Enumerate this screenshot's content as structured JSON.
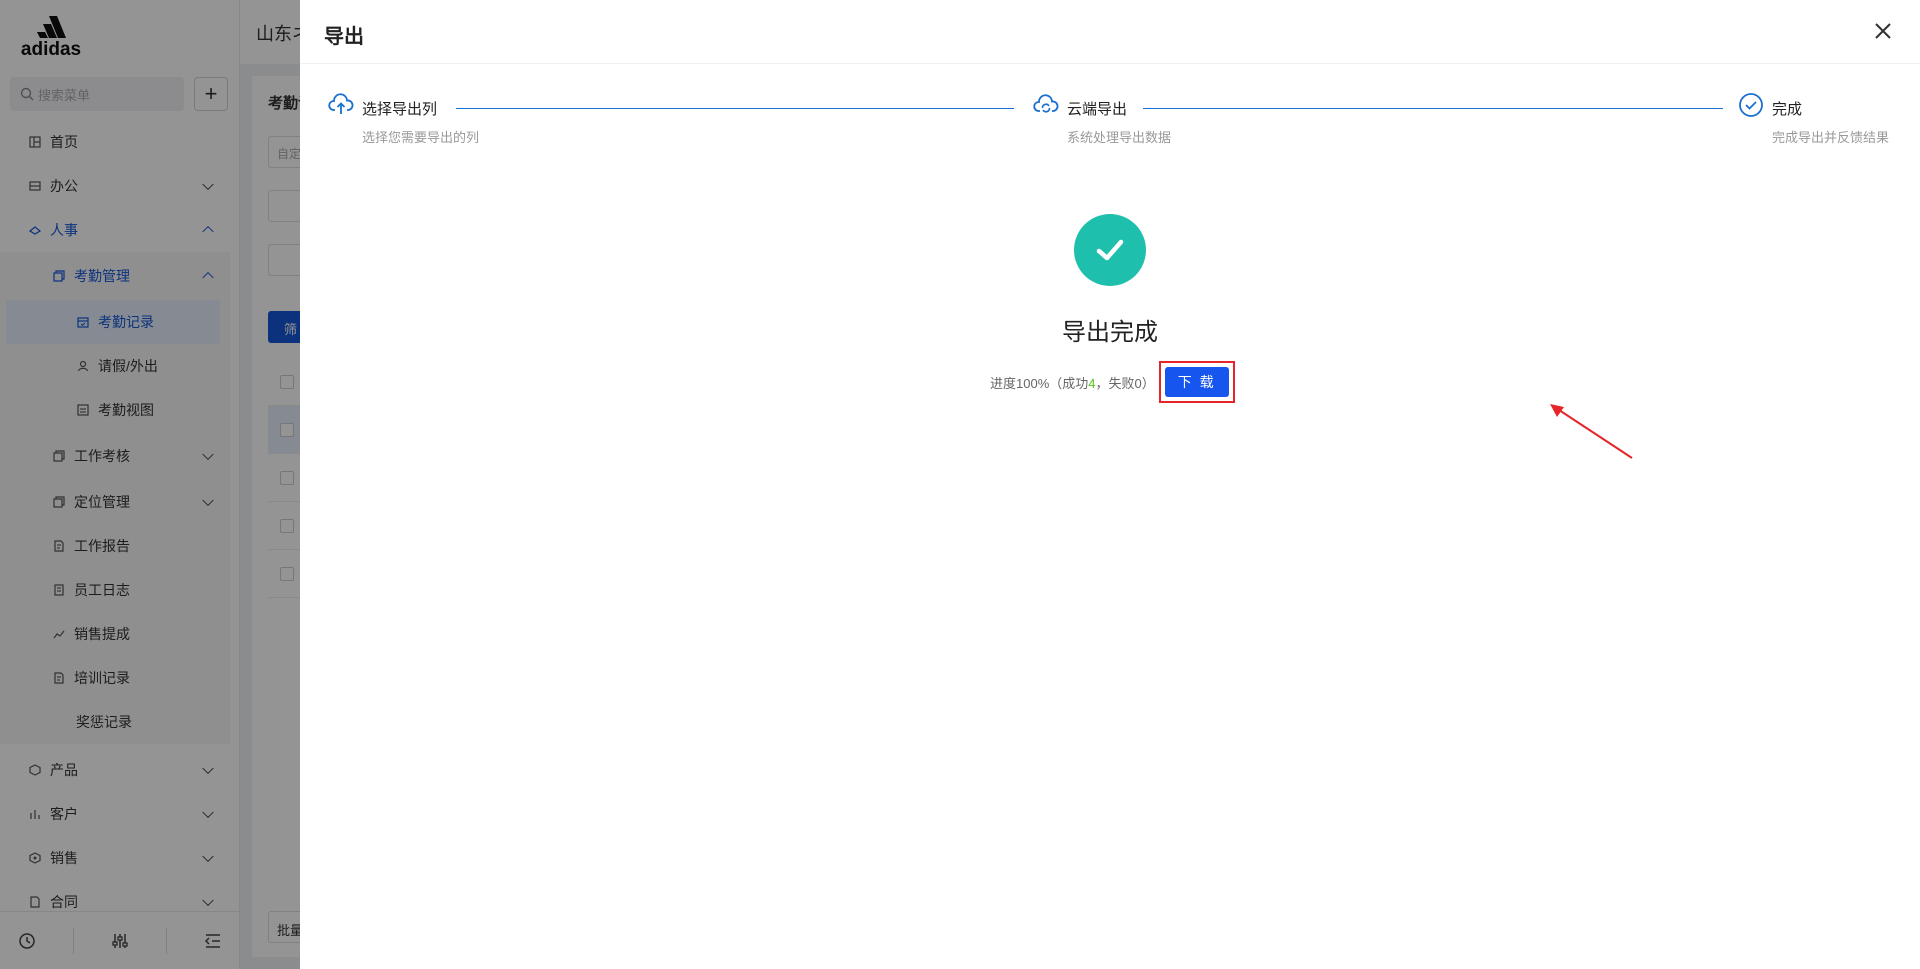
{
  "sidebar": {
    "logo_text": "adidas",
    "search_placeholder": "搜索菜单",
    "add_label": "+",
    "items": [
      {
        "label": "首页",
        "icon": "home-grid-icon"
      },
      {
        "label": "办公",
        "icon": "office-icon"
      },
      {
        "label": "人事",
        "icon": "hr-icon"
      },
      {
        "label": "考勤管理",
        "icon": "attendance-icon"
      },
      {
        "label": "考勤记录",
        "icon": "calendar-icon"
      },
      {
        "label": "请假/外出",
        "icon": "leave-icon"
      },
      {
        "label": "考勤视图",
        "icon": "view-icon"
      },
      {
        "label": "工作考核",
        "icon": "copy-icon"
      },
      {
        "label": "定位管理",
        "icon": "copy-icon"
      },
      {
        "label": "工作报告",
        "icon": "report-icon"
      },
      {
        "label": "员工日志",
        "icon": "log-icon"
      },
      {
        "label": "销售提成",
        "icon": "chart-icon"
      },
      {
        "label": "培训记录",
        "icon": "report-icon"
      },
      {
        "label": "奖惩记录",
        "icon": ""
      },
      {
        "label": "产品",
        "icon": "box-icon"
      },
      {
        "label": "客户",
        "icon": "customer-icon"
      },
      {
        "label": "销售",
        "icon": "sales-icon"
      },
      {
        "label": "合同",
        "icon": "contract-icon"
      }
    ]
  },
  "topbar": {
    "company": "山东ネ"
  },
  "content": {
    "page_title": "考勤记",
    "filter_placeholder": "自定",
    "filter_btn": "筛",
    "batch_btn": "批量"
  },
  "drawer": {
    "title": "导出",
    "steps": [
      {
        "title": "选择导出列",
        "desc": "选择您需要导出的列"
      },
      {
        "title": "云端导出",
        "desc": "系统处理导出数据"
      },
      {
        "title": "完成",
        "desc": "完成导出并反馈结果"
      }
    ],
    "result_title": "导出完成",
    "progress_prefix": "进度100%（成功",
    "success_count": "4",
    "progress_mid": "，失败",
    "fail_count": "0",
    "progress_suffix": "）",
    "download_label": "下 载"
  },
  "colors": {
    "primary": "#1656ef",
    "success": "#1fbfad",
    "highlight": "#e5252a"
  }
}
